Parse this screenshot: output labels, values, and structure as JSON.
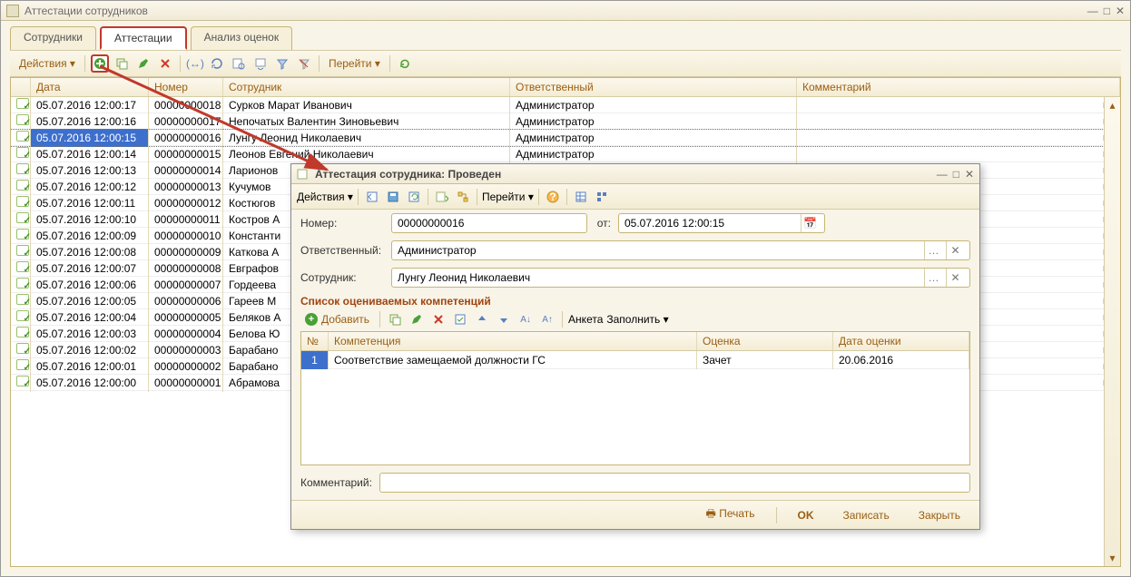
{
  "window": {
    "title": "Аттестации сотрудников"
  },
  "tabs": {
    "employees": "Сотрудники",
    "attestations": "Аттестации",
    "analysis": "Анализ оценок"
  },
  "toolbar": {
    "actions": "Действия",
    "goto": "Перейти"
  },
  "grid": {
    "headers": {
      "date": "Дата",
      "number": "Номер",
      "employee": "Сотрудник",
      "responsible": "Ответственный",
      "comment": "Комментарий"
    },
    "rows": [
      {
        "date": "05.07.2016 12:00:17",
        "number": "00000000018",
        "employee": "Сурков Марат Иванович",
        "responsible": "Администратор"
      },
      {
        "date": "05.07.2016 12:00:16",
        "number": "00000000017",
        "employee": "Непочатых Валентин Зиновьевич",
        "responsible": "Администратор"
      },
      {
        "date": "05.07.2016 12:00:15",
        "number": "00000000016",
        "employee": "Лунгу Леонид Николаевич",
        "responsible": "Администратор",
        "selected": true
      },
      {
        "date": "05.07.2016 12:00:14",
        "number": "00000000015",
        "employee": "Леонов Евгений Николаевич",
        "responsible": "Администратор"
      },
      {
        "date": "05.07.2016 12:00:13",
        "number": "00000000014",
        "employee": "Ларионов",
        "responsible": ""
      },
      {
        "date": "05.07.2016 12:00:12",
        "number": "00000000013",
        "employee": "Кучумов",
        "responsible": ""
      },
      {
        "date": "05.07.2016 12:00:11",
        "number": "00000000012",
        "employee": "Костюгов",
        "responsible": ""
      },
      {
        "date": "05.07.2016 12:00:10",
        "number": "00000000011",
        "employee": "Костров А",
        "responsible": ""
      },
      {
        "date": "05.07.2016 12:00:09",
        "number": "00000000010",
        "employee": "Константи",
        "responsible": ""
      },
      {
        "date": "05.07.2016 12:00:08",
        "number": "00000000009",
        "employee": "Каткова А",
        "responsible": ""
      },
      {
        "date": "05.07.2016 12:00:07",
        "number": "00000000008",
        "employee": "Евграфов",
        "responsible": ""
      },
      {
        "date": "05.07.2016 12:00:06",
        "number": "00000000007",
        "employee": "Гордеева",
        "responsible": ""
      },
      {
        "date": "05.07.2016 12:00:05",
        "number": "00000000006",
        "employee": "Гареев М",
        "responsible": ""
      },
      {
        "date": "05.07.2016 12:00:04",
        "number": "00000000005",
        "employee": "Беляков А",
        "responsible": ""
      },
      {
        "date": "05.07.2016 12:00:03",
        "number": "00000000004",
        "employee": "Белова Ю",
        "responsible": ""
      },
      {
        "date": "05.07.2016 12:00:02",
        "number": "00000000003",
        "employee": "Барабано",
        "responsible": ""
      },
      {
        "date": "05.07.2016 12:00:01",
        "number": "00000000002",
        "employee": "Барабано",
        "responsible": ""
      },
      {
        "date": "05.07.2016 12:00:00",
        "number": "00000000001",
        "employee": "Абрамова",
        "responsible": ""
      }
    ]
  },
  "dialog": {
    "title": "Аттестация сотрудника: Проведен",
    "actions": "Действия",
    "goto": "Перейти",
    "labels": {
      "number": "Номер:",
      "from": "от:",
      "responsible": "Ответственный:",
      "employee": "Сотрудник:",
      "section": "Список оцениваемых компетенций",
      "add": "Добавить",
      "survey": "Анкета",
      "fill": "Заполнить",
      "comment": "Комментарий:"
    },
    "fields": {
      "number": "00000000016",
      "date": "05.07.2016 12:00:15",
      "responsible": "Администратор",
      "employee": "Лунгу Леонид Николаевич"
    },
    "comp_headers": {
      "n": "№",
      "comp": "Компетенция",
      "mark": "Оценка",
      "dt": "Дата оценки"
    },
    "comp_rows": [
      {
        "n": "1",
        "comp": "Соответствие замещаемой должности ГС",
        "mark": "Зачет",
        "dt": "20.06.2016"
      }
    ],
    "footer": {
      "print": "Печать",
      "ok": "OK",
      "save": "Записать",
      "close": "Закрыть"
    }
  }
}
